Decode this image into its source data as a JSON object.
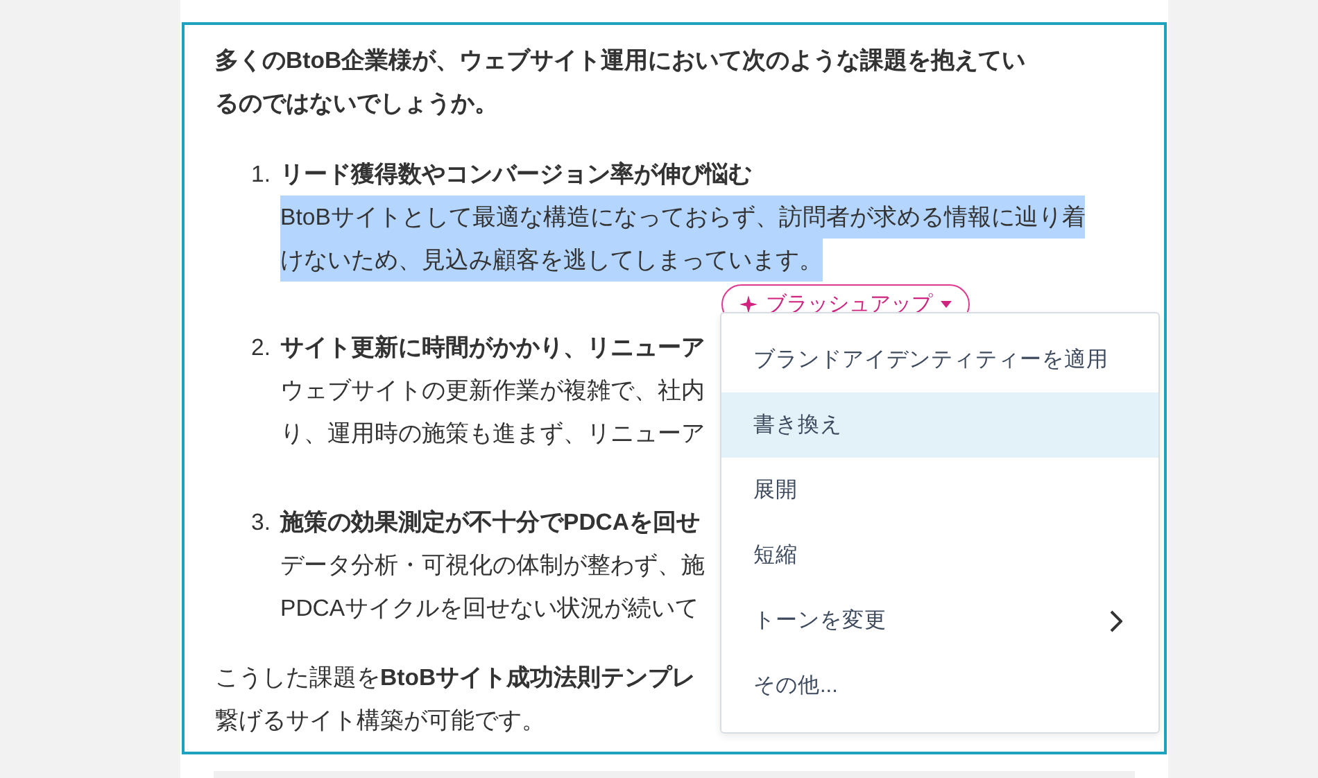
{
  "intro_lines": [
    "多くのBtoB企業様が、ウェブサイト運用において次のような課題を抱えてい",
    "るのではないでしょうか。"
  ],
  "items": [
    {
      "number": "1.",
      "title": "リード獲得数やコンバージョン率が伸び悩む",
      "highlighted": true,
      "lines": [
        "BtoBサイトとして最適な構造になっておらず、訪問者が求める情報に辿り着",
        "けないため、見込み顧客を逃してしまっています。"
      ]
    },
    {
      "number": "2.",
      "title": "サイト更新に時間がかかり、リニューア",
      "highlighted": false,
      "lines": [
        "ウェブサイトの更新作業が複雑で、社内",
        "り、運用時の施策も進まず、リニューア"
      ]
    },
    {
      "number": "3.",
      "title": "施策の効果測定が不十分でPDCAを回せ",
      "highlighted": false,
      "lines": [
        "データ分析・可視化の体制が整わず、施",
        "PDCAサイクルを回せない状況が続いて"
      ]
    }
  ],
  "closing_lines": [
    "こうした課題を**BtoBサイト成功法則テンプレ**",
    "繋げるサイト構築が可能です。"
  ],
  "brushup_button": {
    "label": "ブラッシュアップ"
  },
  "menu": [
    {
      "label": "ブランドアイデンティティーを適用",
      "kind": "action",
      "selected": false
    },
    {
      "label": "書き換え",
      "kind": "action",
      "selected": true
    },
    {
      "label": "展開",
      "kind": "action",
      "selected": false
    },
    {
      "label": "短縮",
      "kind": "action",
      "selected": false
    },
    {
      "label": "トーンを変更",
      "kind": "submenu",
      "selected": false
    },
    {
      "label": "その他...",
      "kind": "action",
      "selected": false
    }
  ]
}
